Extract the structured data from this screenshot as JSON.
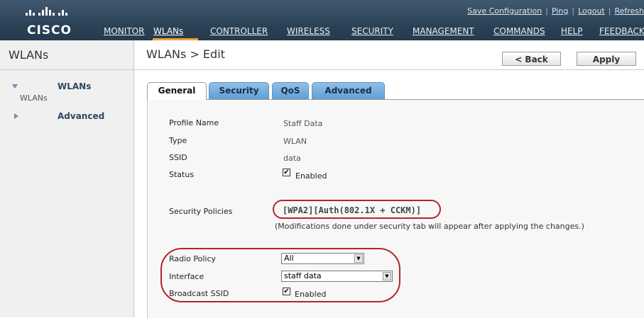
{
  "header": {
    "logo_text": "CISCO",
    "toplinks": [
      "Save Configuration",
      "Ping",
      "Logout",
      "Refresh"
    ],
    "nav": [
      "MONITOR",
      "WLANs",
      "CONTROLLER",
      "WIRELESS",
      "SECURITY",
      "MANAGEMENT",
      "COMMANDS",
      "HELP",
      "FEEDBACK"
    ],
    "active_nav": "WLANs"
  },
  "sidebar": {
    "title": "WLANs",
    "items": [
      {
        "label": "WLANs",
        "sub": "WLANs",
        "expanded": true
      },
      {
        "label": "Advanced",
        "expanded": false
      }
    ]
  },
  "main": {
    "breadcrumb": "WLANs > Edit",
    "back_label": "< Back",
    "apply_label": "Apply",
    "tabs": [
      "General",
      "Security",
      "QoS",
      "Advanced"
    ],
    "active_tab": "General"
  },
  "form": {
    "profile_name_label": "Profile Name",
    "profile_name_value": "Staff Data",
    "type_label": "Type",
    "type_value": "WLAN",
    "ssid_label": "SSID",
    "ssid_value": "data",
    "status_label": "Status",
    "status_checkbox_label": "Enabled",
    "status_checked": true,
    "security_policies_label": "Security Policies",
    "security_policies_value": "[WPA2][Auth(802.1X + CCKM)]",
    "security_note": "(Modifications done under security tab will appear after applying the changes.)",
    "radio_policy_label": "Radio Policy",
    "radio_policy_value": "All",
    "interface_label": "Interface",
    "interface_value": "staff data",
    "broadcast_ssid_label": "Broadcast SSID",
    "broadcast_checkbox_label": "Enabled",
    "broadcast_checked": true
  },
  "colors": {
    "header_bg": "#2c4257",
    "nav_accent": "#f1a13b",
    "tab_blue": "#5f9fd6",
    "annotation_red": "#b3262b"
  }
}
